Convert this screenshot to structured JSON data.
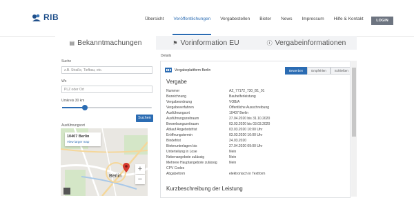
{
  "logo": {
    "text": "RIB"
  },
  "nav": {
    "items": [
      "Übersicht",
      "Veröffentlichungen",
      "Vergabestellen",
      "Bieter",
      "News",
      "Impressum",
      "Hilfe & Kontakt"
    ],
    "active_index": 1,
    "login_label": "LOGIN"
  },
  "tabs": [
    {
      "label": "Bekanntmachungen",
      "icon": "megaphone-icon",
      "active": true
    },
    {
      "label": "Vorinformation EU",
      "icon": "flag-icon",
      "active": false
    },
    {
      "label": "Vergabeinformationen",
      "icon": "info-icon",
      "active": false
    }
  ],
  "search": {
    "search_label": "Suche",
    "search_placeholder": "z.B. Straße, Tiefbau, etc.",
    "where_label": "Wo",
    "where_placeholder": "PLZ oder Ort",
    "radius_label": "Umkreis 30 km",
    "radius_fraction": 0.25,
    "button_label": "Suchen",
    "results_label": "Ausführungsort"
  },
  "map": {
    "card_title": "10407 Berlin",
    "card_link": "View larger map",
    "city_label": "Berlin"
  },
  "details": {
    "label": "Details",
    "platform_label": "Vergabeplattform Berlin",
    "buttons": [
      "Bewerben",
      "Empfehlen",
      "Schließen"
    ],
    "section_title": "Vergabe",
    "rows": [
      {
        "key": "Nummer",
        "value": "AZ_77172_730_B1_01"
      },
      {
        "key": "Bezeichnung",
        "value": "Bauhelferleistung"
      },
      {
        "key": "Vergabeordnung",
        "value": "VOB/A"
      },
      {
        "key": "Vergabeverfahren",
        "value": "Öffentliche Ausschreibung"
      },
      {
        "key": "Ausführungsort",
        "value": "10407 Berlin"
      },
      {
        "key": "Ausführungszeitraum",
        "value": "27.04.2020 bis 31.10.2020"
      },
      {
        "key": "Bewerbungszeitraum",
        "value": "03.03.2020 bis 03.03.2020"
      },
      {
        "key": "Ablauf Angebotsfrist",
        "value": "03.03.2020 10:00 Uhr"
      },
      {
        "key": "Eröffnungstermin",
        "value": "03.03.2020 10:00 Uhr"
      },
      {
        "key": "Bindefrist",
        "value": "24.03.2020"
      },
      {
        "key": "Bieterunterlagen bis",
        "value": "27.04.2020 09:00 Uhr"
      },
      {
        "key": "Unterteilung in Lose",
        "value": "Nein"
      },
      {
        "key": "Nebenangebote zulässig",
        "value": "Nein"
      },
      {
        "key": "Mehrere Hauptangebote zulässig",
        "value": "Nein"
      },
      {
        "key": "CPV Codes",
        "value": ""
      },
      {
        "key": "Abgabeform",
        "value": "elektronisch in Textform"
      }
    ],
    "next_section_title": "Kurzbeschreibung der Leistung"
  },
  "colors": {
    "accent": "#2b6cb3",
    "login_bg": "#6d7480"
  }
}
